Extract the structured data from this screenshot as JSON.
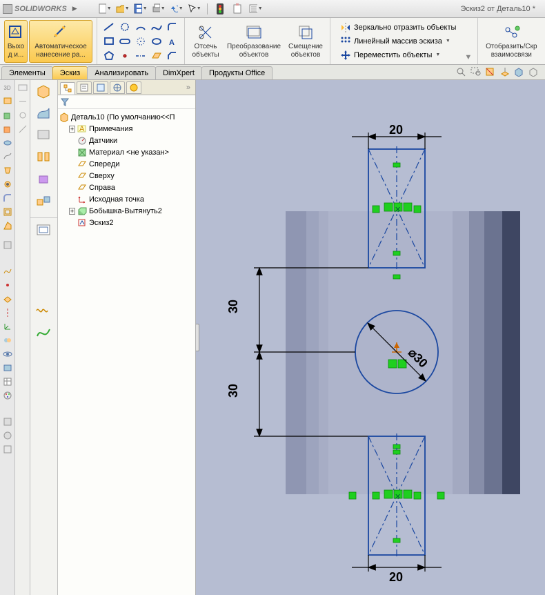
{
  "app": {
    "name": "SOLIDWORKS",
    "doc_title": "Эскиз2 от Деталь10 *"
  },
  "ribbon": {
    "exit_sketch": "Выхо\nд и...",
    "smart_dim": "Автоматическое\nнанесение ра...",
    "trim": "Отсечь\nобъекты",
    "convert": "Преобразование\nобъектов",
    "offset": "Смещение\nобъектов",
    "mirror": "Зеркально отразить объекты",
    "linear": "Линейный массив эскиза",
    "move": "Переместить объекты",
    "display": "Отобразить/Скр\nвзаимосвязи"
  },
  "tabs": {
    "elements": "Элементы",
    "sketch": "Эскиз",
    "analyze": "Анализировать",
    "dimxpert": "DimXpert",
    "office": "Продукты Office"
  },
  "tree": {
    "root": "Деталь10 (По умолчанию<<П",
    "annotations": "Примечания",
    "sensors": "Датчики",
    "material": "Материал <не указан>",
    "front": "Спереди",
    "top": "Сверху",
    "right": "Справа",
    "origin": "Исходная точка",
    "boss": "Бобышка-Вытянуть2",
    "sketch": "Эскиз2"
  },
  "dims": {
    "top_width": "20",
    "bottom_width": "20",
    "upper_30": "30",
    "lower_30": "30",
    "diameter": "⌀30"
  }
}
